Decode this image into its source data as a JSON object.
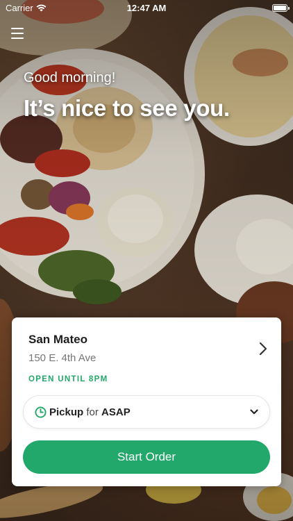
{
  "status_bar": {
    "carrier": "Carrier",
    "time": "12:47 AM"
  },
  "greeting": "Good morning!",
  "headline": "It’s nice to see you.",
  "location": {
    "name": "San Mateo",
    "address": "150 E. 4th Ave",
    "open_status": "OPEN UNTIL 8PM"
  },
  "order_mode": {
    "type": "Pickup",
    "connector": "for",
    "time": "ASAP"
  },
  "start_order_label": "Start Order",
  "colors": {
    "accent": "#22a86b"
  }
}
